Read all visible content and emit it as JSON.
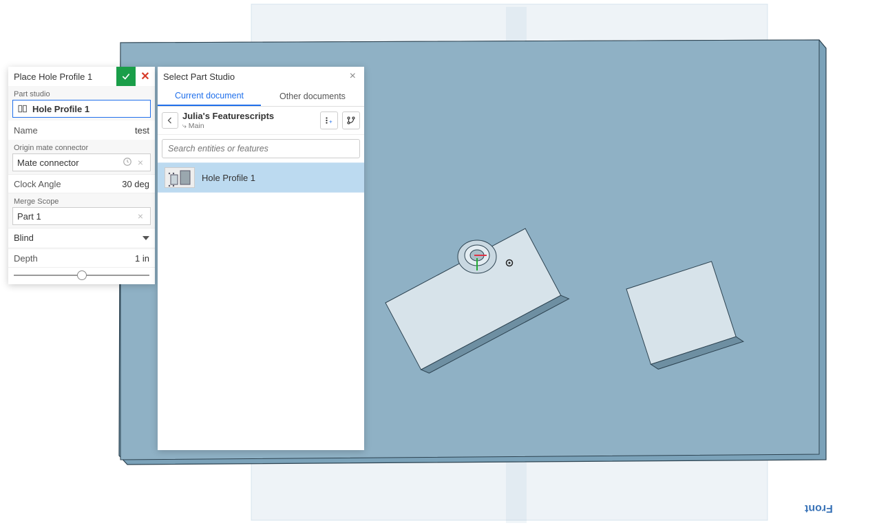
{
  "leftPanel": {
    "title": "Place Hole Profile 1",
    "partStudioLabel": "Part studio",
    "partStudioValue": "Hole Profile 1",
    "nameLabel": "Name",
    "nameValue": "test",
    "originLabel": "Origin mate connector",
    "originValue": "Mate connector",
    "clockAngleLabel": "Clock Angle",
    "clockAngleValue": "30 deg",
    "mergeScopeLabel": "Merge Scope",
    "mergeScopeValue": "Part 1",
    "endTypeValue": "Blind",
    "depthLabel": "Depth",
    "depthValue": "1 in"
  },
  "rightPanel": {
    "title": "Select Part Studio",
    "tabCurrent": "Current document",
    "tabOther": "Other documents",
    "breadcrumbTitle": "Julia's Featurescripts",
    "breadcrumbSub": "⤷ Main",
    "searchPlaceholder": "Search entities or features",
    "itemLabel": "Hole Profile 1"
  },
  "viewport": {
    "frontLabel": "Front"
  }
}
